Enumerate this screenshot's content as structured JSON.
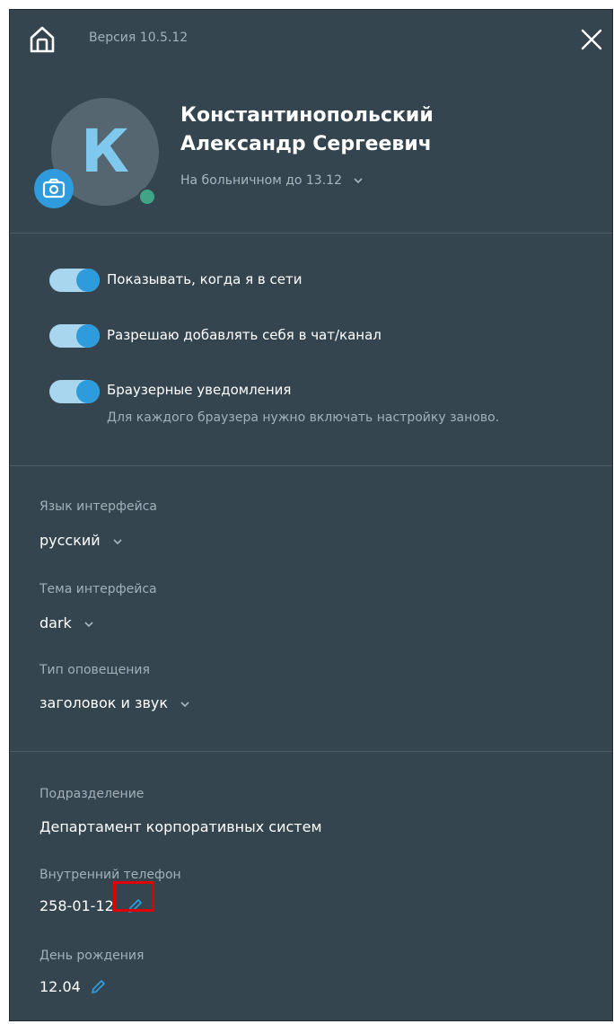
{
  "header": {
    "version_label": "Версия",
    "version_number": "10.5.12"
  },
  "profile": {
    "avatar_letter": "К",
    "name_line1": "Константинопольский",
    "name_line2": "Александр Сергеевич",
    "status": "На больничном до 13.12"
  },
  "toggles": [
    {
      "label": "Показывать, когда я в сети",
      "on": true
    },
    {
      "label": "Разрешаю добавлять себя в чат/канал",
      "on": true
    },
    {
      "label": "Браузерные уведомления",
      "hint": "Для каждого браузера нужно включать настройку заново.",
      "on": true
    }
  ],
  "settings": {
    "language": {
      "label": "Язык интерфейса",
      "value": "русский"
    },
    "theme": {
      "label": "Тема интерфейса",
      "value": "dark"
    },
    "notification": {
      "label": "Тип оповещения",
      "value": "заголовок и звук"
    }
  },
  "info": {
    "department": {
      "label": "Подразделение",
      "value": "Департамент корпоративных систем"
    },
    "phone": {
      "label": "Внутренний телефон",
      "value": "258-01-12"
    },
    "birthday": {
      "label": "День рождения",
      "value": "12.04"
    }
  },
  "colors": {
    "accent": "#2e9bdc",
    "background": "#344550",
    "online": "#3fa585",
    "highlight": "#e00000"
  }
}
